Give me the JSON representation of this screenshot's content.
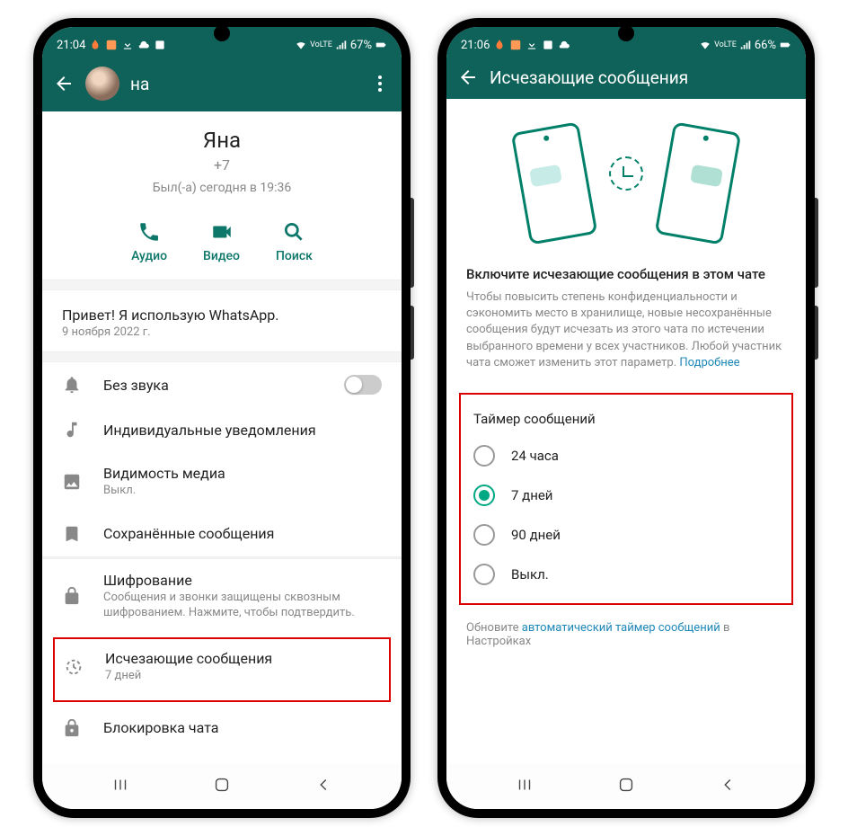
{
  "phone1": {
    "status": {
      "time": "21:04",
      "battery": "67%"
    },
    "header": {
      "name_short": "на"
    },
    "profile": {
      "name": "Яна",
      "phone": "+7",
      "last_seen": "Был(-а) сегодня в 19:36"
    },
    "actions": {
      "audio": "Аудио",
      "video": "Видео",
      "search": "Поиск"
    },
    "about": {
      "text": "Привет! Я использую WhatsApp.",
      "date": "9 ноября 2022 г."
    },
    "items": {
      "mute": "Без звука",
      "custom": "Индивидуальные уведомления",
      "media": "Видимость медиа",
      "media_sub": "Выкл.",
      "saved": "Сохранённые сообщения",
      "encrypt": "Шифрование",
      "encrypt_sub": "Сообщения и звонки защищены сквозным шифрованием. Нажмите, чтобы подтвердить.",
      "disappear": "Исчезающие сообщения",
      "disappear_sub": "7 дней",
      "lock": "Блокировка чата"
    }
  },
  "phone2": {
    "status": {
      "time": "21:06",
      "battery": "66%"
    },
    "header": {
      "title": "Исчезающие сообщения"
    },
    "desc": {
      "title": "Включите исчезающие сообщения в этом чате",
      "text": "Чтобы повысить степень конфиденциальности и сэкономить место в хранилище, новые несохранённые сообщения будут исчезать из этого чата по истечении выбранного времени у всех участников. Любой участник чата сможет изменить этот параметр. ",
      "link": "Подробнее"
    },
    "radio": {
      "title": "Таймер сообщений",
      "opt1": "24 часа",
      "opt2": "7 дней",
      "opt3": "90 дней",
      "opt4": "Выкл."
    },
    "footer": {
      "pre": "Обновите ",
      "link": "автоматический таймер сообщений",
      "post": " в Настройках"
    }
  }
}
